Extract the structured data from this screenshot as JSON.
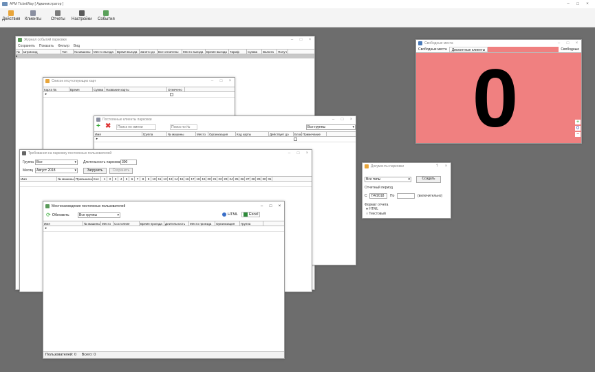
{
  "app": {
    "title": "АРМ TicketWay [ Администратор ]",
    "toolbar": [
      {
        "label": "Действия",
        "icon": "actions-icon"
      },
      {
        "label": "Клиенты",
        "icon": "clients-icon"
      },
      {
        "label": "Отчеты",
        "icon": "reports-icon"
      },
      {
        "label": "Настройки",
        "icon": "settings-icon"
      },
      {
        "label": "События",
        "icon": "events-icon"
      }
    ]
  },
  "journal": {
    "title": "Журнал событий парковки",
    "menu": [
      "Сохранить",
      "Показать",
      "Фильтр",
      "Вид"
    ],
    "columns": [
      "№",
      "Штрихкод",
      "Тип",
      "№ машины",
      "Место въезда",
      "Время въезда",
      "Занято до",
      "Все оплачены",
      "Место выезда",
      "Время выезда",
      "Тариф",
      "Сумма",
      "Валюта",
      "Получ"
    ]
  },
  "free_places": {
    "title": "Свободные места",
    "tabs": [
      "Свободные места",
      "Дисконтные клиенты"
    ],
    "right_tab": "Свободные",
    "count": "0",
    "accent": "#f08080"
  },
  "absent_cards": {
    "title": "Список отсутствующих карт",
    "columns": [
      "Карта №",
      "Время",
      "Сумма",
      "Название карты",
      "Отмечено"
    ]
  },
  "permanent_clients": {
    "title": "Постоянные клиенты парковки",
    "search_placeholder": "Поиск по имени",
    "search2_placeholder": "Поиск по №",
    "group_value": "Все группы",
    "columns": [
      "Имя",
      "Группа",
      "№ машины",
      "Место",
      "Организация",
      "Код карты",
      "Действует до",
      "Блок",
      "Примечание"
    ]
  },
  "violations": {
    "title": "Требования на парковку постоянных пользователей",
    "group_label": "Группа",
    "group_value": "Все",
    "month_label": "Месяц",
    "month_value": "Август 2018",
    "duration_label": "Длительность парковки",
    "duration_value": "300",
    "load_label": "Загрузить",
    "save_label": "Сохранить",
    "columns": [
      "Имя",
      "№ машины",
      "Превышение",
      "Кол"
    ],
    "days": [
      "1",
      "2",
      "3",
      "4",
      "5",
      "6",
      "7",
      "8",
      "9",
      "10",
      "11",
      "12",
      "13",
      "14",
      "15",
      "16",
      "17",
      "18",
      "19",
      "20",
      "21",
      "22",
      "23",
      "24",
      "25",
      "26",
      "27",
      "28",
      "29",
      "30",
      "31"
    ]
  },
  "location": {
    "title": "Местонахождение постоянных пользователей",
    "refresh_label": "Обновить",
    "group_value": "Все группы",
    "html_label": "HTML",
    "excel_label": "Excel",
    "columns": [
      "Имя",
      "№ машины",
      "Место",
      "Состояние",
      "Время проезда",
      "Длительность",
      "Место проезда",
      "Организация",
      "Группа"
    ],
    "status_total_label": "Пользователей:",
    "status_total": "0",
    "status_present_label": "Всего:",
    "status_present": "0"
  },
  "doc_report": {
    "title": "Документы парковки",
    "type_value": "Все типы",
    "create_label": "Создать",
    "period_label": "Отчетный период",
    "from_label": "С",
    "from_value": "7/4/2018",
    "to_label": "По",
    "to_note": "(включительно)",
    "format_label": "Формат отчета",
    "formats": [
      "HTML",
      "Текстовый"
    ]
  }
}
